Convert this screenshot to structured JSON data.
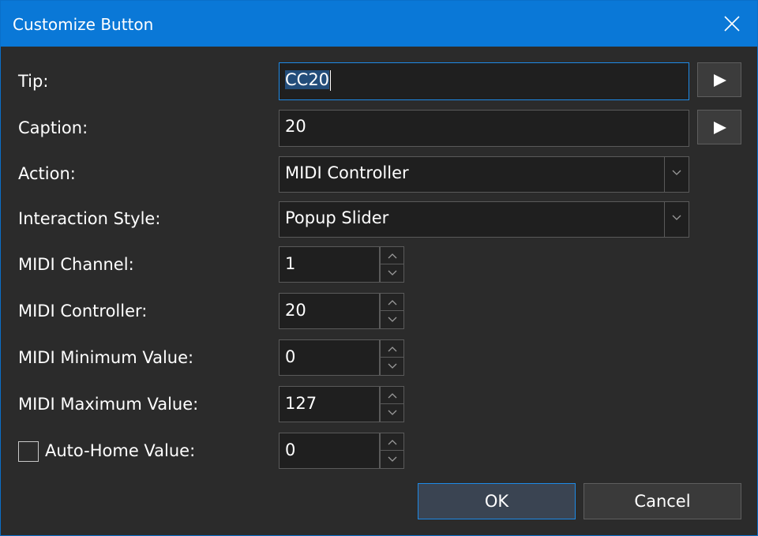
{
  "window": {
    "title": "Customize Button",
    "accent_color": "#0a78d7"
  },
  "form": {
    "tip": {
      "label": "Tip:",
      "value": "CC20"
    },
    "caption": {
      "label": "Caption:",
      "value": "20"
    },
    "action": {
      "label": "Action:",
      "value": "MIDI Controller"
    },
    "interaction_style": {
      "label": "Interaction Style:",
      "value": "Popup Slider"
    },
    "midi_channel": {
      "label": "MIDI Channel:",
      "value": "1"
    },
    "midi_controller": {
      "label": "MIDI Controller:",
      "value": "20"
    },
    "midi_min": {
      "label": "MIDI Minimum Value:",
      "value": "0"
    },
    "midi_max": {
      "label": "MIDI Maximum Value:",
      "value": "127"
    },
    "auto_home": {
      "label": "Auto-Home Value:",
      "value": "0",
      "checked": false
    }
  },
  "buttons": {
    "ok": "OK",
    "cancel": "Cancel"
  },
  "icons": {
    "close": "close-icon",
    "play": "play-icon",
    "dropdown": "chevron-down-icon",
    "spin_up": "chevron-up-icon",
    "spin_down": "chevron-down-icon"
  }
}
